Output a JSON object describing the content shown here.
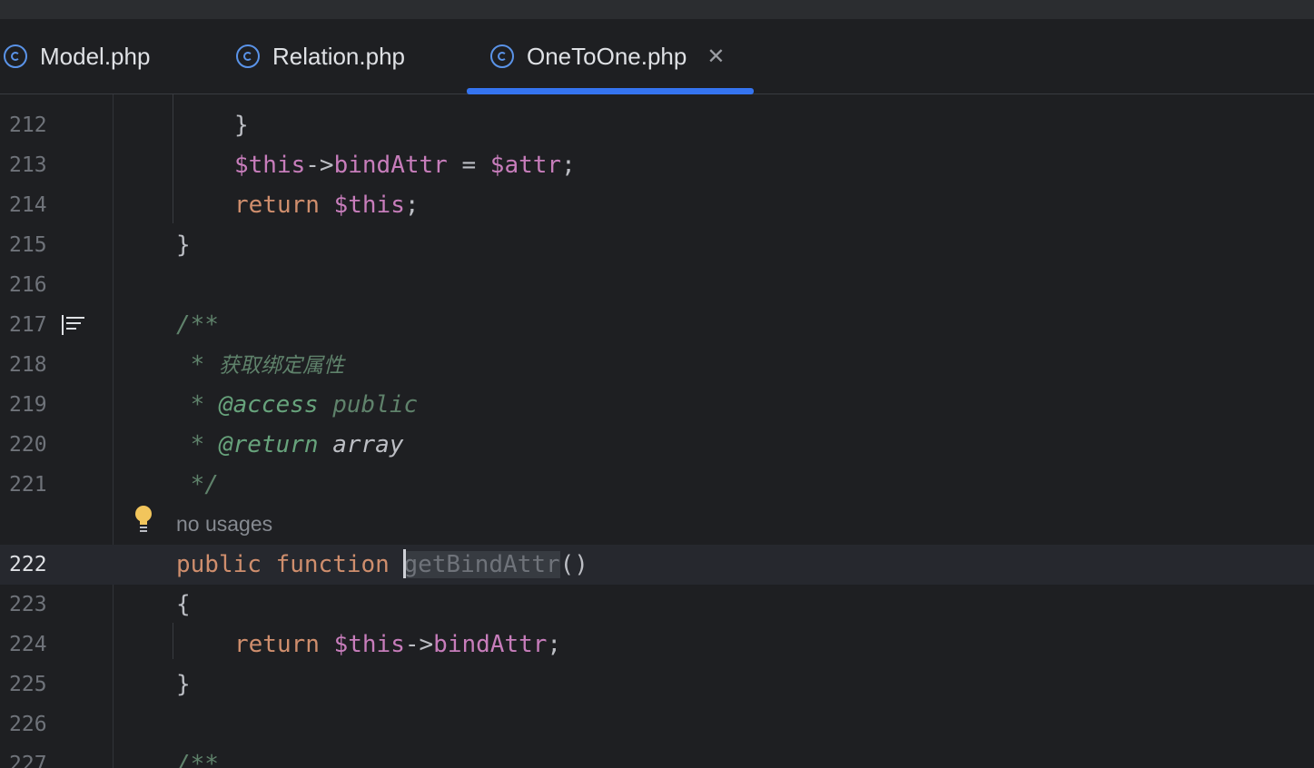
{
  "tabs": [
    {
      "label": "Model.php",
      "active": false
    },
    {
      "label": "Relation.php",
      "active": false
    },
    {
      "label": "OneToOne.php",
      "active": true,
      "close": "✕"
    }
  ],
  "colors": {
    "accent": "#3574f0",
    "keyword": "#cf8e6d",
    "variable": "#c77dbb",
    "doc_comment": "#5f826b",
    "background": "#1e1f22"
  },
  "lines": {
    "l212": {
      "num": "212",
      "brace": "}"
    },
    "l213": {
      "num": "213",
      "var1": "$this",
      "arrow": "->",
      "field": "bindAttr",
      "eq": " = ",
      "var2": "$attr",
      "semi": ";"
    },
    "l214": {
      "num": "214",
      "kw": "return",
      "var": "$this",
      "semi": ";"
    },
    "l215": {
      "num": "215",
      "brace": "}"
    },
    "l216": {
      "num": "216"
    },
    "l217": {
      "num": "217",
      "text": "/**"
    },
    "l218": {
      "num": "218",
      "star": " * ",
      "text": "获取绑定属性"
    },
    "l219": {
      "num": "219",
      "star": " * ",
      "tag": "@access",
      "value": "public"
    },
    "l220": {
      "num": "220",
      "star": " * ",
      "tag": "@return",
      "value": "array"
    },
    "l221": {
      "num": "221",
      "text": " */"
    },
    "l222": {
      "num": "222",
      "kw1": "public",
      "kw2": "function",
      "name": "getBindAttr",
      "parens": "()"
    },
    "l223": {
      "num": "223",
      "brace": "{"
    },
    "l224": {
      "num": "224",
      "kw": "return",
      "var": "$this",
      "arrow": "->",
      "field": "bindAttr",
      "semi": ";"
    },
    "l225": {
      "num": "225",
      "brace": "}"
    },
    "l226": {
      "num": "226"
    },
    "l227": {
      "num": "227",
      "text": "/**"
    }
  },
  "inlay_hint": "no usages",
  "icons": {
    "file_icon": "php-class-icon",
    "doc_render": "doc-render-icon",
    "bulb": "lightbulb-icon"
  }
}
